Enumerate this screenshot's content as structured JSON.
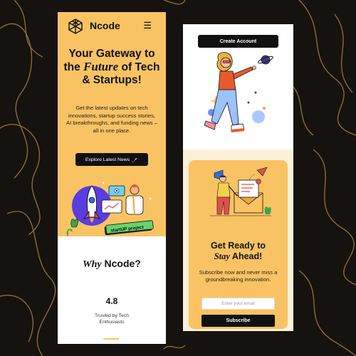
{
  "colors": {
    "background": "#15120f",
    "accent": "#f9c363",
    "button": "#111111",
    "cream": "#fdf0d9"
  },
  "brand": {
    "name": "Ncode",
    "logo_icon": "cube-grid-icon"
  },
  "nav": {
    "menu_icon": "hamburger-menu-icon"
  },
  "hero": {
    "title_before": "Your Gateway to the ",
    "title_emphasis": "Future",
    "title_after": " of Tech & Startups!",
    "subtitle": "Get the latest updates on tech innovations, startup success stories, AI breakthroughs, and funding news – all in one place.",
    "cta_label": "Explore Latest News",
    "cta_icon": "rocket-icon",
    "illustration_label": "startUP project"
  },
  "why": {
    "title_emphasis": "Why",
    "title_rest": " Ncode?"
  },
  "rating": {
    "value": "4.8",
    "label": "Trusted by Tech Enthusiasts"
  },
  "account": {
    "create_label": "Create Account"
  },
  "subscribe": {
    "title_line1": "Get Ready to",
    "title_emphasis": "Stay",
    "title_rest": " Ahead!",
    "text": "Subscribe now and never miss a groundbreaking innovation.",
    "email_placeholder": "Enter your email",
    "button_label": "Subscribe"
  }
}
